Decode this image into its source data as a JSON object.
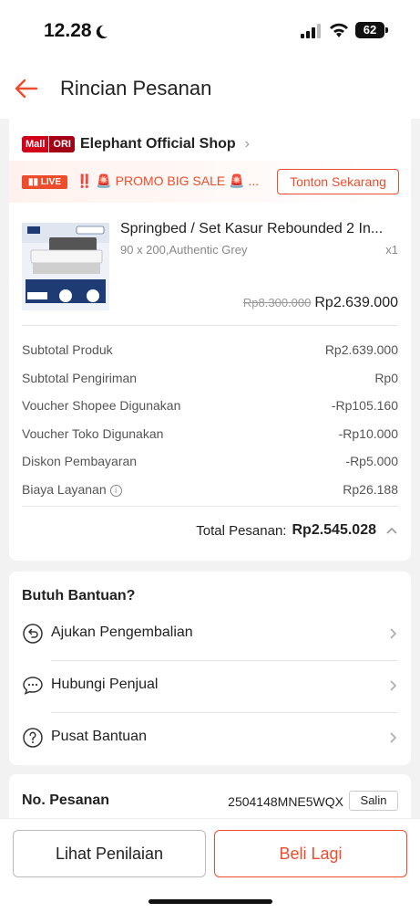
{
  "status_bar": {
    "time": "12.28",
    "battery": "62"
  },
  "header": {
    "title": "Rincian Pesanan"
  },
  "shop": {
    "badge_mall": "Mall",
    "badge_ori": "ORI",
    "name": "Elephant Official Shop"
  },
  "promo": {
    "live_label": "LIVE",
    "text": "‼️ 🚨 PROMO BIG SALE 🚨 ...",
    "watch_label": "Tonton Sekarang"
  },
  "product": {
    "title": "Springbed / Set Kasur Rebounded 2 In...",
    "variant": "90 x 200,Authentic Grey",
    "qty": "x1",
    "price_original": "Rp8.300.000",
    "price_now": "Rp2.639.000"
  },
  "summary": [
    {
      "label": "Subtotal Produk",
      "value": "Rp2.639.000"
    },
    {
      "label": "Subtotal Pengiriman",
      "value": "Rp0"
    },
    {
      "label": "Voucher Shopee Digunakan",
      "value": "-Rp105.160"
    },
    {
      "label": "Voucher Toko Digunakan",
      "value": "-Rp10.000"
    },
    {
      "label": "Diskon Pembayaran",
      "value": "-Rp5.000"
    },
    {
      "label": "Biaya Layanan",
      "value": "Rp26.188"
    }
  ],
  "total": {
    "label": "Total Pesanan:",
    "value": "Rp2.545.028"
  },
  "help": {
    "title": "Butuh Bantuan?",
    "items": [
      {
        "label": "Ajukan Pengembalian",
        "icon": "return-icon"
      },
      {
        "label": "Hubungi Penjual",
        "icon": "chat-icon"
      },
      {
        "label": "Pusat Bantuan",
        "icon": "help-icon"
      }
    ]
  },
  "order_number": {
    "label": "No. Pesanan",
    "value": "2504148MNE5WQX",
    "copy_label": "Salin"
  },
  "actions": {
    "review_label": "Lihat Penilaian",
    "buy_again_label": "Beli Lagi"
  },
  "colors": {
    "accent": "#ee4d2d",
    "mall_red": "#d0011b"
  }
}
